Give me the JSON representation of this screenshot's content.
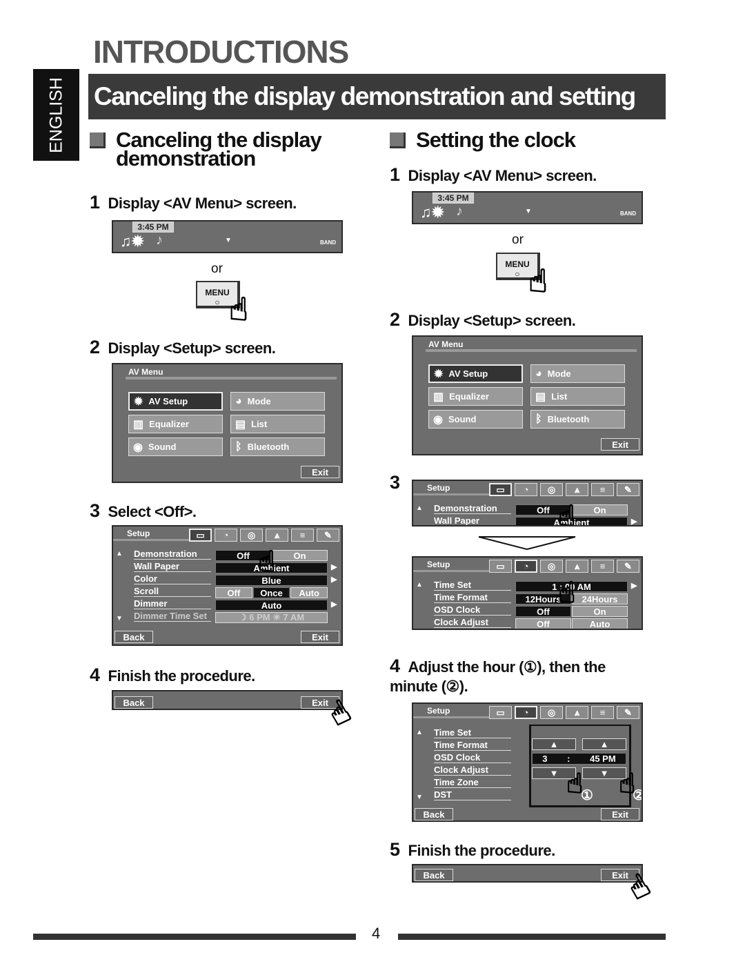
{
  "header": {
    "section": "INTRODUCTIONS",
    "language_tab": "ENGLISH",
    "title": "Canceling the display demonstration and setting the clock"
  },
  "left": {
    "heading_line1": "Canceling the display",
    "heading_line2": "demonstration",
    "steps": [
      {
        "num": "1",
        "text": "Display <AV Menu> screen."
      },
      {
        "num": "2",
        "text": "Display <Setup> screen."
      },
      {
        "num": "3",
        "text": "Select <Off>."
      },
      {
        "num": "4",
        "text": "Finish the procedure."
      }
    ],
    "or": "or"
  },
  "right": {
    "heading": "Setting the clock",
    "steps": [
      {
        "num": "1",
        "text": "Display <AV Menu> screen."
      },
      {
        "num": "2",
        "text": "Display <Setup> screen."
      },
      {
        "num": "3",
        "text": ""
      },
      {
        "num": "4",
        "text": "Adjust the hour (①), then the minute (②)."
      },
      {
        "num": "5",
        "text": "Finish the procedure."
      }
    ],
    "or": "or"
  },
  "av_bar": {
    "time": "3:45",
    "ampm": "PM",
    "band": "BAND",
    "icons": [
      "music-note-icon",
      "gear-icon",
      "phone-icon",
      "triangle-down-icon"
    ]
  },
  "menu_button": {
    "label": "MENU"
  },
  "av_menu": {
    "title": "AV Menu",
    "items": [
      {
        "label": "AV Setup",
        "icon": "gear-icon",
        "selected": true
      },
      {
        "label": "Mode",
        "icon": "mode-icon"
      },
      {
        "label": "Equalizer",
        "icon": "equalizer-icon"
      },
      {
        "label": "List",
        "icon": "list-icon"
      },
      {
        "label": "Sound",
        "icon": "sound-icon"
      },
      {
        "label": "Bluetooth",
        "icon": "bluetooth-icon"
      }
    ],
    "exit": "Exit"
  },
  "setup": {
    "title": "Setup",
    "tabs": [
      "display-icon",
      "clock-icon",
      "disc-icon",
      "antenna-icon",
      "input-icon",
      "wrench-icon"
    ],
    "back": "Back",
    "exit": "Exit"
  },
  "setup_display": {
    "rows": [
      {
        "label": "Demonstration",
        "cells": [
          {
            "t": "Off",
            "s": "dark"
          },
          {
            "t": "On",
            "s": "gray"
          }
        ]
      },
      {
        "label": "Wall Paper",
        "cells": [
          {
            "t": "Ambient",
            "s": "dark"
          }
        ],
        "arrow": true
      },
      {
        "label": "Color",
        "cells": [
          {
            "t": "Blue",
            "s": "dark"
          }
        ],
        "arrow": true
      },
      {
        "label": "Scroll",
        "cells": [
          {
            "t": "Off",
            "s": "gray"
          },
          {
            "t": "Once",
            "s": "dark"
          },
          {
            "t": "Auto",
            "s": "gray"
          }
        ]
      },
      {
        "label": "Dimmer",
        "cells": [
          {
            "t": "Auto",
            "s": "dark"
          }
        ],
        "arrow": true
      },
      {
        "label": "Dimmer Time Set",
        "cells": [
          {
            "t": "☽ 6 PM    ☀ 7 AM",
            "s": "gray"
          }
        ],
        "dim": true
      }
    ]
  },
  "setup_partial": {
    "rows": [
      {
        "label": "Demonstration",
        "cells": [
          {
            "t": "Off",
            "s": "dark"
          },
          {
            "t": "On",
            "s": "gray"
          }
        ]
      },
      {
        "label": "Wall Paper",
        "cells": [
          {
            "t": "Ambient",
            "s": "dark"
          }
        ],
        "arrow": true
      }
    ]
  },
  "setup_clock": {
    "rows": [
      {
        "label": "Time Set",
        "cells": [
          {
            "t": "1   :   00 AM",
            "s": "dark"
          }
        ],
        "arrow": true
      },
      {
        "label": "Time Format",
        "cells": [
          {
            "t": "12Hours",
            "s": "dark"
          },
          {
            "t": "24Hours",
            "s": "gray"
          }
        ]
      },
      {
        "label": "OSD Clock",
        "cells": [
          {
            "t": "Off",
            "s": "dark"
          },
          {
            "t": "On",
            "s": "gray"
          }
        ]
      },
      {
        "label": "Clock Adjust",
        "cells": [
          {
            "t": "Off",
            "s": "gray"
          },
          {
            "t": "Auto",
            "s": "gray"
          }
        ]
      }
    ]
  },
  "setup_timeset": {
    "rows": [
      "Time Set",
      "Time Format",
      "OSD Clock",
      "Clock Adjust",
      "Time Zone",
      "DST"
    ],
    "hour": "3",
    "colon": ":",
    "minute": "45",
    "ampm": "PM",
    "callout1": "①",
    "callout2": "②"
  },
  "page_number": "4"
}
